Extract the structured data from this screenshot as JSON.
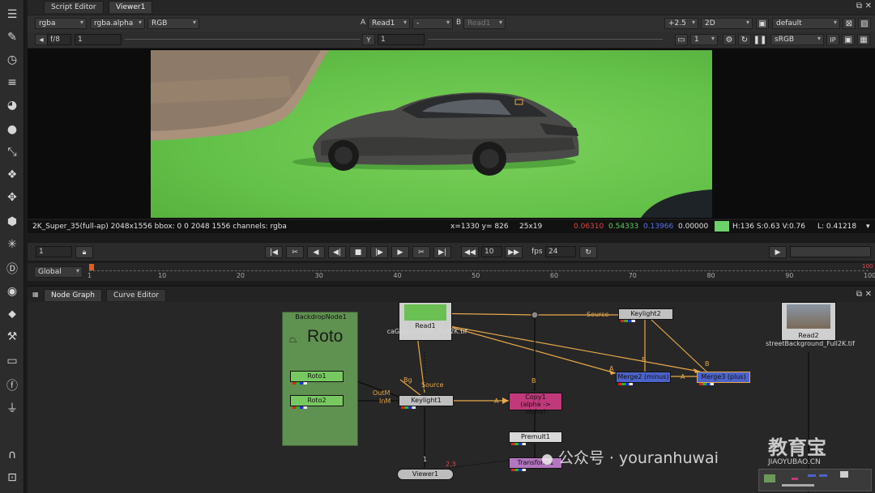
{
  "left_toolbar": [
    "toolbar-icon",
    "paint-icon",
    "time-icon",
    "channel-icon",
    "color-icon",
    "filter-icon",
    "keyer-icon",
    "merge-icon",
    "transform-icon",
    "3d-icon",
    "particles-icon",
    "deep-icon",
    "views-icon",
    "metadata-icon",
    "toolsets-icon",
    "other-icon",
    "furnace-icon",
    "plugin-icon",
    "gizmo-icon",
    "misc-icon"
  ],
  "tabs": {
    "script_editor": "Script Editor",
    "viewer": "Viewer1"
  },
  "viewer_toolbar": {
    "channel_set": "rgba",
    "alpha_channel": "rgba.alpha",
    "display_channel": "RGB",
    "a_label": "A",
    "a_input": "Read1",
    "a_dash": "-",
    "b_label": "B",
    "b_input": "Read1",
    "gain": "+2.5",
    "view_mode": "2D",
    "lut": "default",
    "fstop": "f/8",
    "gain_value": "1",
    "y_label": "Y",
    "y_value": "1",
    "proxy_value": "1",
    "colorspace": "sRGB",
    "ip_label": "IP"
  },
  "info_bar": {
    "format": "2K_Super_35(full-ap) 2048x1556 bbox: 0 0 2048 1556 channels: rgba",
    "coords": "x=1330 y= 826",
    "size": "25x19",
    "red": "0.06310",
    "green": "0.54333",
    "blue": "0.13966",
    "alpha": "0.00000",
    "hsv": "H:136 S:0.63 V:0.76",
    "luma": "L: 0.41218",
    "swatch_color": "#6cd16a"
  },
  "playback": {
    "frame": "1",
    "increment": "10",
    "fps_label": "fps",
    "fps": "24"
  },
  "timeline": {
    "scope": "Global",
    "ticks": [
      "1",
      "10",
      "20",
      "30",
      "40",
      "50",
      "60",
      "70",
      "80",
      "90",
      "100"
    ],
    "end_marker": "100"
  },
  "node_graph": {
    "tabs": [
      "Node Graph",
      "Curve Editor"
    ],
    "backdrop_title": "BackdropNode1",
    "backdrop_label": "Roto",
    "nodes": {
      "read1": "Read1",
      "read1_file": "caGreenscreen_Full2K.tif",
      "read2": "Read2",
      "read2_file": "streetBackground_Full2K.tif",
      "roto1": "Roto1",
      "roto2": "Roto2",
      "keylight1": "Keylight1",
      "keylight2": "Keylight2",
      "copy1": "Copy1",
      "copy1_sub": "(alpha -> alpha)",
      "merge2": "Merge2 (minus)",
      "merge3": "Merge3 (plus)",
      "premult": "Premult1",
      "transform": "Transform1",
      "viewer": "Viewer1"
    },
    "edge_labels": {
      "bg": "Bg",
      "source1": "Source",
      "outm": "OutM",
      "inm": "InM",
      "a1": "A",
      "b1": "B",
      "source2": "Source",
      "b2": "B",
      "b3": "B",
      "a2": "A",
      "a3": "A",
      "viewer_in": "1",
      "viewer_in2": "2,3"
    }
  },
  "watermark": {
    "wechat": "公众号 · youranhuwai",
    "brand": "教育宝",
    "domain": "JIAOYUBAO.CN"
  }
}
